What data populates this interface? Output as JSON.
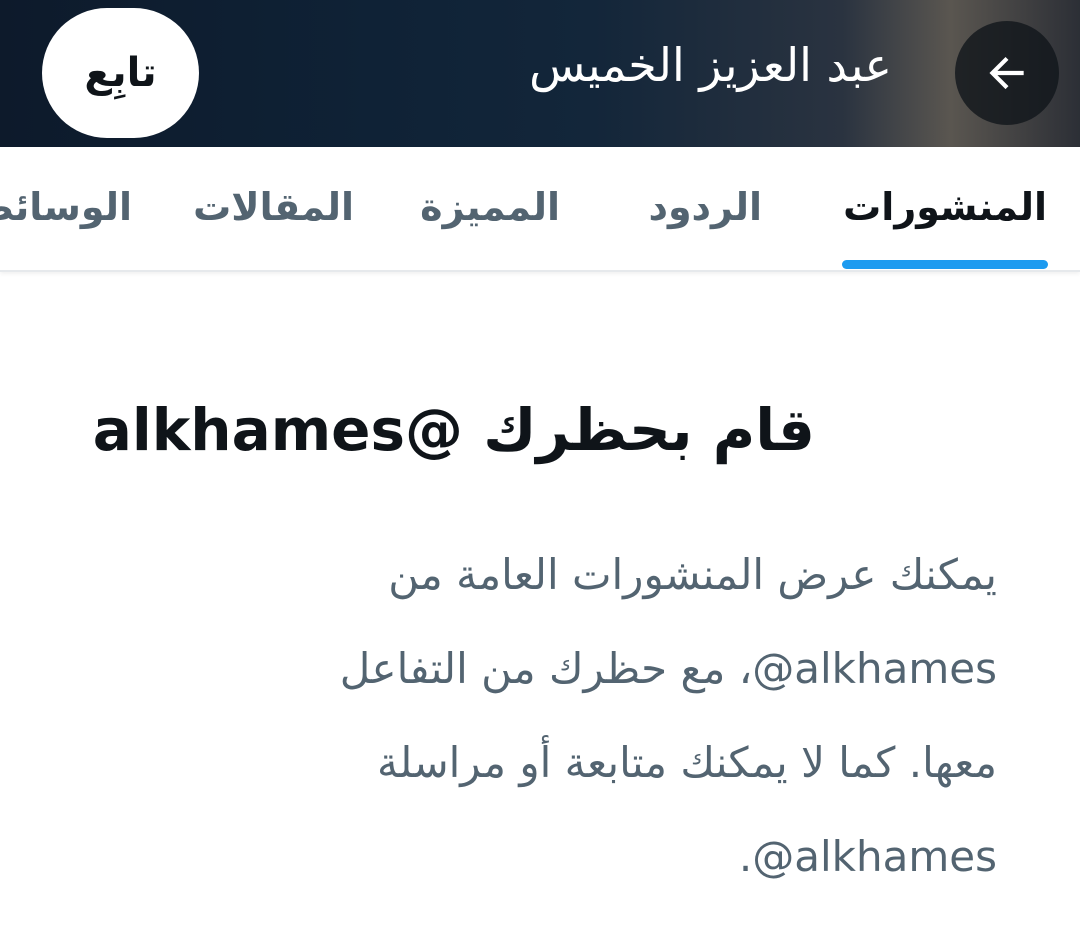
{
  "header": {
    "title": "عبد العزيز الخميس",
    "back_icon": "arrow-left-icon",
    "follow_label": "تابِع"
  },
  "tabs": [
    {
      "label": "المنشورات",
      "active": true
    },
    {
      "label": "الردود",
      "active": false
    },
    {
      "label": "المميزة",
      "active": false
    },
    {
      "label": "المقالات",
      "active": false
    },
    {
      "label": "الوسائط",
      "active": false
    }
  ],
  "blocked": {
    "title": "قام بحظرك @alkhames",
    "description": "يمكنك عرض المنشورات العامة من ‎@alkhames‏، مع حظرك من التفاعل معها. كما لا يمكنك متابعة أو مراسلة ‎@alkhames‏."
  },
  "colors": {
    "accent": "#1d9bf0",
    "text_primary": "#0f1419",
    "text_secondary": "#536471",
    "header_bg": "#0f2236"
  }
}
